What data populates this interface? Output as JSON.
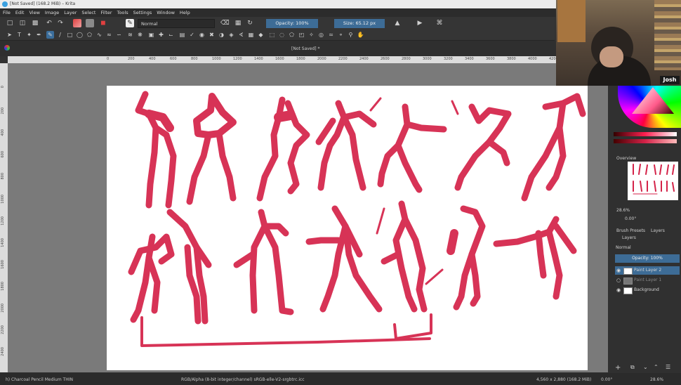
{
  "window": {
    "title": "[Not Saved]  (168.2 MiB)  – Krita"
  },
  "menu": [
    "File",
    "Edit",
    "View",
    "Image",
    "Layer",
    "Select",
    "Filter",
    "Tools",
    "Settings",
    "Window",
    "Help"
  ],
  "toolbar": {
    "blend_mode": "Normal",
    "opacity_label": "Opacity: 100%",
    "size_label": "Size: 65.12 px"
  },
  "document": {
    "tab_title": "[Not Saved]  *"
  },
  "rulers": {
    "horizontal": [
      "0",
      "200",
      "400",
      "600",
      "800",
      "1000",
      "1200",
      "1400",
      "1600",
      "1800",
      "2000",
      "2200",
      "2400",
      "2600",
      "2800",
      "3000",
      "3200",
      "3400",
      "3600",
      "3800",
      "4000",
      "4200"
    ],
    "vertical": [
      "0",
      "200",
      "400",
      "600",
      "800",
      "1000",
      "1200",
      "1400",
      "1600",
      "1800",
      "2000",
      "2200",
      "2400"
    ]
  },
  "webcam": {
    "name_tag": "Josh"
  },
  "dock": {
    "overview_title": "Overview",
    "zoom_value": "28.6%",
    "rotation_value": "0.00°",
    "tabs": [
      "Brush Presets",
      "Layers"
    ],
    "layers_title": "Layers",
    "layer_blend_mode": "Normal",
    "layer_opacity": "Opacity: 100%",
    "layers": [
      {
        "name": "Paint Layer 2",
        "active": true
      },
      {
        "name": "Paint Layer 1",
        "active": false
      },
      {
        "name": "Background",
        "active": false
      }
    ]
  },
  "status": {
    "brush": "h) Charcoal Pencil Medium THIN",
    "color_space": "RGB/Alpha (8-bit integer/channel)  sRGB-elle-V2-srgbtrc.icc",
    "dimensions": "4,560 x 2,880 (168.2 MiB)",
    "rotation": "0.00°",
    "zoom": "28.6%"
  },
  "colors": {
    "accent": "#3d6c96",
    "stroke": "#d42248",
    "canvas_bg": "#7a7a7a"
  }
}
